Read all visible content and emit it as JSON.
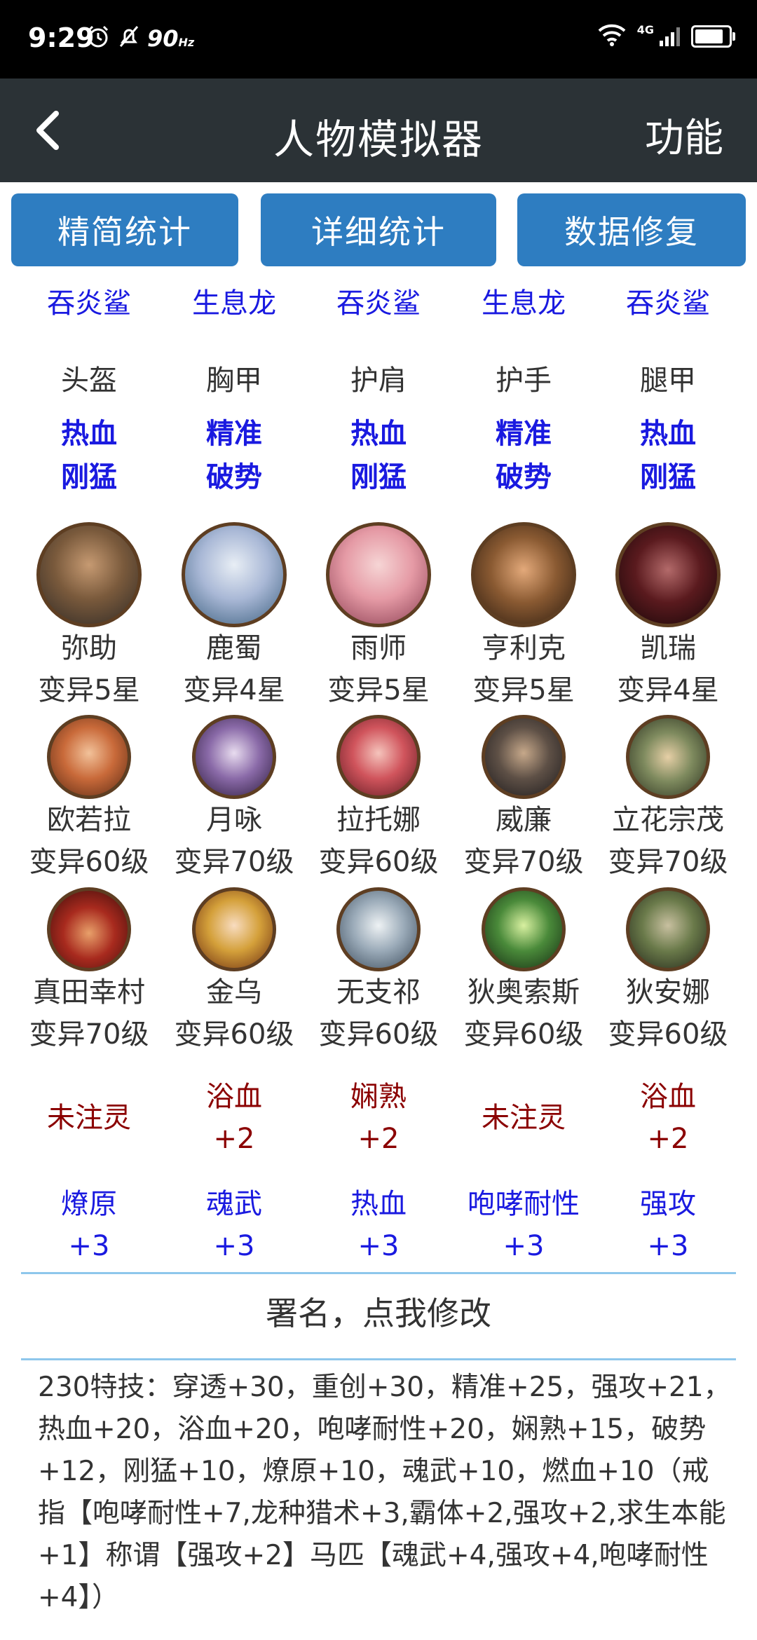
{
  "status": {
    "time": "9:29",
    "refresh_rate": "90",
    "refresh_unit": "Hz",
    "network": "4G",
    "battery_level": 0.85,
    "icons": [
      "alarm-icon",
      "mute-icon",
      "wifi-icon",
      "signal-icon",
      "battery-icon"
    ]
  },
  "appbar": {
    "title": "人物模拟器",
    "action": "功能"
  },
  "buttons": {
    "simple": "精简统计",
    "detail": "详细统计",
    "repair": "数据修复"
  },
  "equipment": [
    {
      "pet": "吞炎鲨",
      "slot": "头盔",
      "attr1": "热血",
      "attr2": "刚猛"
    },
    {
      "pet": "生息龙",
      "slot": "胸甲",
      "attr1": "精准",
      "attr2": "破势"
    },
    {
      "pet": "吞炎鲨",
      "slot": "护肩",
      "attr1": "热血",
      "attr2": "刚猛"
    },
    {
      "pet": "生息龙",
      "slot": "护手",
      "attr1": "精准",
      "attr2": "破势"
    },
    {
      "pet": "吞炎鲨",
      "slot": "腿甲",
      "attr1": "热血",
      "attr2": "刚猛"
    }
  ],
  "heroes_main": [
    {
      "name": "弥助",
      "level": "变异5星"
    },
    {
      "name": "鹿蜀",
      "level": "变异4星"
    },
    {
      "name": "雨师",
      "level": "变异5星"
    },
    {
      "name": "亨利克",
      "level": "变异5星"
    },
    {
      "name": "凯瑞",
      "level": "变异4星"
    }
  ],
  "heroes_row2": [
    {
      "name": "欧若拉",
      "level": "变异60级"
    },
    {
      "name": "月咏",
      "level": "变异70级"
    },
    {
      "name": "拉托娜",
      "level": "变异60级"
    },
    {
      "name": "威廉",
      "level": "变异70级"
    },
    {
      "name": "立花宗茂",
      "level": "变异70级"
    }
  ],
  "heroes_row3": [
    {
      "name": "真田幸村",
      "level": "变异70级"
    },
    {
      "name": "金乌",
      "level": "变异60级"
    },
    {
      "name": "无支祁",
      "level": "变异60级"
    },
    {
      "name": "狄奥索斯",
      "level": "变异60级"
    },
    {
      "name": "狄安娜",
      "level": "变异60级"
    }
  ],
  "souls": [
    {
      "name": "未注灵",
      "value": ""
    },
    {
      "name": "浴血",
      "value": "+2"
    },
    {
      "name": "娴熟",
      "value": "+2"
    },
    {
      "name": "未注灵",
      "value": ""
    },
    {
      "name": "浴血",
      "value": "+2"
    }
  ],
  "skills": [
    {
      "name": "燎原",
      "value": "+3"
    },
    {
      "name": "魂武",
      "value": "+3"
    },
    {
      "name": "热血",
      "value": "+3"
    },
    {
      "name": "咆哮耐性",
      "value": "+3"
    },
    {
      "name": "强攻",
      "value": "+3"
    }
  ],
  "signature": "署名，点我修改",
  "summary": "230特技：穿透+30，重创+30，精准+25，强攻+21，热血+20，浴血+20，咆哮耐性+20，娴熟+15，破势+12，刚猛+10，燎原+10，魂武+10，燃血+10（戒指【咆哮耐性+7,龙种猎术+3,霸体+2,强攻+2,求生本能+1】称谓【强攻+2】马匹【魂武+4,强攻+4,咆哮耐性+4】）",
  "colors": {
    "status_bar": "#000000",
    "app_bar": "#2b3236",
    "button": "#2e7dc1",
    "blue_text": "#1a1ae0",
    "red_text": "#8b0000",
    "divider": "#8ec7ec"
  }
}
